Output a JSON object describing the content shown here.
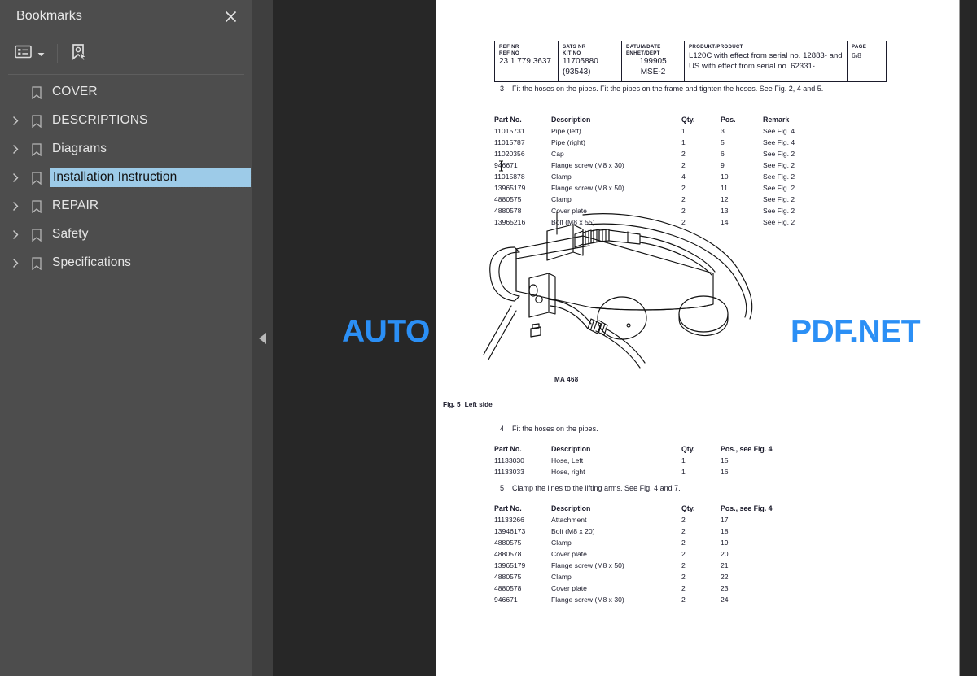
{
  "panel": {
    "title": "Bookmarks",
    "close_icon": "close-icon",
    "toolbar": {
      "options_label": "list-options-icon",
      "dropdown_label": "chevron-down-icon",
      "find_bookmark_label": "select-bookmark-icon"
    },
    "items": [
      {
        "label": "COVER",
        "expandable": false,
        "selected": false
      },
      {
        "label": "DESCRIPTIONS",
        "expandable": true,
        "selected": false
      },
      {
        "label": "Diagrams",
        "expandable": true,
        "selected": false
      },
      {
        "label": "Installation Instruction",
        "expandable": true,
        "selected": true
      },
      {
        "label": "REPAIR",
        "expandable": true,
        "selected": false
      },
      {
        "label": "Safety",
        "expandable": true,
        "selected": false
      },
      {
        "label": "Specifications",
        "expandable": true,
        "selected": false
      }
    ]
  },
  "splitter": {
    "collapse_icon": "collapse-left-triangle-icon"
  },
  "watermark": {
    "left_part": "AUTO",
    "right_part": "PDF.NET",
    "color": "#2b8ff5"
  },
  "document": {
    "header": {
      "ref": {
        "cap_line1": "REF NR",
        "cap_line2": "REF NO",
        "value": "23 1 779 3637"
      },
      "kit": {
        "cap_line1": "SATS NR",
        "cap_line2": "KIT NO",
        "value": "11705880",
        "value2": "(93543)"
      },
      "date": {
        "cap_line1": "DATUM/DATE",
        "cap_line2": "ENHET/DEPT",
        "value": "199905",
        "value2": "MSE-2"
      },
      "product": {
        "cap": "PRODUKT/PRODUCT",
        "value": "L120C with effect from serial no. 12883- and US with effect from serial no. 62331-"
      },
      "page": {
        "cap": "PAGE",
        "value": "6/8"
      }
    },
    "step3": {
      "num": "3",
      "text": "Fit the hoses on the pipes. Fit the pipes on the frame and tighten the hoses. See Fig. 2, 4 and 5."
    },
    "table3": {
      "headers": [
        "Part No.",
        "Description",
        "Qty.",
        "Pos.",
        "Remark"
      ],
      "rows": [
        [
          "11015731",
          "Pipe (left)",
          "1",
          "3",
          "See Fig. 4"
        ],
        [
          "11015787",
          "Pipe (right)",
          "1",
          "5",
          "See Fig. 4"
        ],
        [
          "11020356",
          "Cap",
          "2",
          "6",
          "See Fig. 2"
        ],
        [
          "946671",
          "Flange screw (M8 x 30)",
          "2",
          "9",
          "See Fig. 2"
        ],
        [
          "11015878",
          "Clamp",
          "4",
          "10",
          "See Fig. 2"
        ],
        [
          "13965179",
          "Flange screw (M8 x 50)",
          "2",
          "11",
          "See Fig. 2"
        ],
        [
          "4880575",
          "Clamp",
          "2",
          "12",
          "See Fig. 2"
        ],
        [
          "4880578",
          "Cover plate",
          "2",
          "13",
          "See Fig. 2"
        ],
        [
          "13965216",
          "Bolt (M8 x 55)",
          "2",
          "14",
          "See Fig. 2"
        ]
      ]
    },
    "figure": {
      "id_label": "MA 468",
      "caption_num": "Fig. 5",
      "caption_text": "Left side"
    },
    "step4": {
      "num": "4",
      "text": "Fit the hoses on the pipes."
    },
    "table4": {
      "headers": [
        "Part No.",
        "Description",
        "Qty.",
        "Pos., see Fig. 4"
      ],
      "rows": [
        [
          "11133030",
          "Hose, Left",
          "1",
          "15"
        ],
        [
          "11133033",
          "Hose, right",
          "1",
          "16"
        ]
      ]
    },
    "step5": {
      "num": "5",
      "text": "Clamp the lines to the lifting arms. See Fig. 4 and 7."
    },
    "table5": {
      "headers": [
        "Part No.",
        "Description",
        "Qty.",
        "Pos., see Fig. 4"
      ],
      "rows": [
        [
          "11133266",
          "Attachment",
          "2",
          "17"
        ],
        [
          "13946173",
          "Bolt (M8 x 20)",
          "2",
          "18"
        ],
        [
          "4880575",
          "Clamp",
          "2",
          "19"
        ],
        [
          "4880578",
          "Cover plate",
          "2",
          "20"
        ],
        [
          "13965179",
          "Flange screw (M8 x 50)",
          "2",
          "21"
        ],
        [
          "4880575",
          "Clamp",
          "2",
          "22"
        ],
        [
          "4880578",
          "Cover plate",
          "2",
          "23"
        ],
        [
          "946671",
          "Flange screw (M8 x 30)",
          "2",
          "24"
        ]
      ]
    }
  }
}
